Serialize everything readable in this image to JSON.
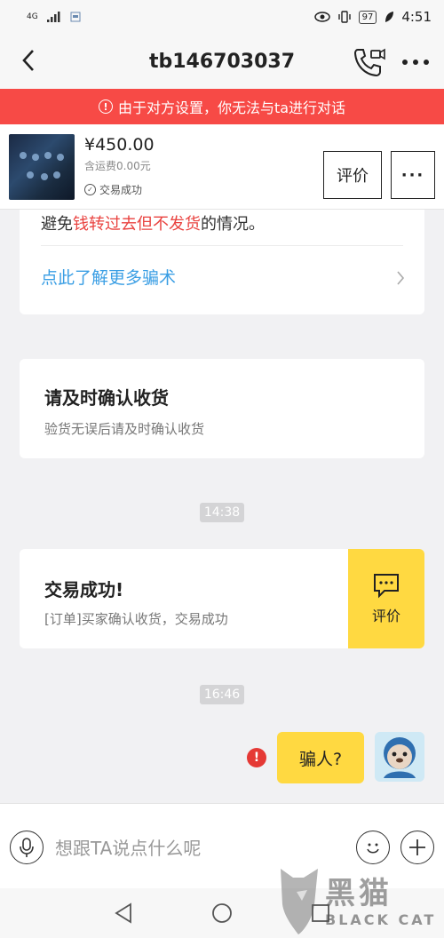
{
  "status_bar": {
    "network": "4G",
    "battery": "97",
    "time": "4:51"
  },
  "header": {
    "title": "tb146703037"
  },
  "banner": {
    "text": "由于对方设置，你无法与ta进行对话"
  },
  "product": {
    "price": "¥450.00",
    "shipping": "含运费0.00元",
    "status": "交易成功",
    "review_label": "评价",
    "more_label": "···"
  },
  "scam_card": {
    "text_before": "避免",
    "text_highlight": "钱转过去但不发货",
    "text_after": "的情况。",
    "link": "点此了解更多骗术",
    "highlight_color": "#e94340",
    "link_color": "#3a9ee4"
  },
  "confirm_card": {
    "title": "请及时确认收货",
    "subtitle": "验货无误后请及时确认收货"
  },
  "messages": {
    "time1": "14:38",
    "time2": "16:46",
    "my_message": "骗人?"
  },
  "done_card": {
    "title": "交易成功!",
    "subtitle": "[订单]买家确认收货，交易成功",
    "review_label": "评价",
    "accent_color": "#ffd941"
  },
  "input_bar": {
    "placeholder": "想跟TA说点什么呢"
  },
  "watermark": {
    "text": "黑猫",
    "sub": "BLACK CAT"
  },
  "colors": {
    "banner": "#f74a46",
    "error": "#e53935",
    "bubble": "#ffd941"
  }
}
